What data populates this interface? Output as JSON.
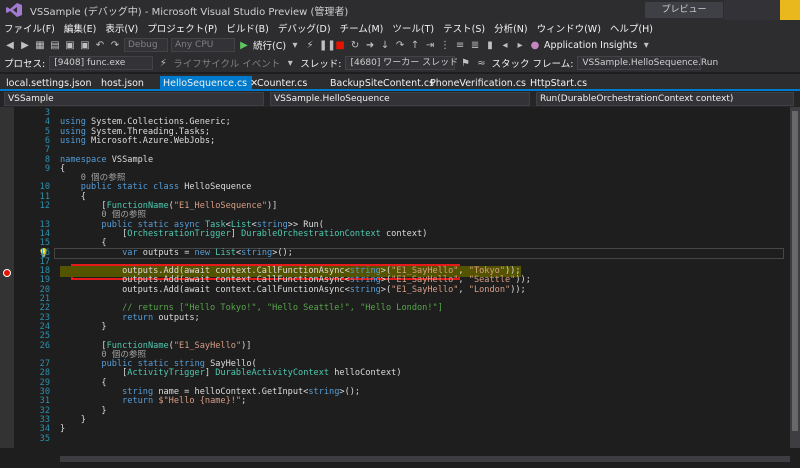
{
  "window": {
    "title": "VSSample (デバッグ中) - Microsoft Visual Studio Preview (管理者)",
    "preview_label": "プレビュー"
  },
  "menu": [
    "ファイル(F)",
    "編集(E)",
    "表示(V)",
    "プロジェクト(P)",
    "ビルド(B)",
    "デバッグ(D)",
    "チーム(M)",
    "ツール(T)",
    "テスト(S)",
    "分析(N)",
    "ウィンドウ(W)",
    "ヘルプ(H)"
  ],
  "toolbar": {
    "config": "Debug",
    "platform": "Any CPU",
    "continue_label": "続行(C)",
    "app_insights": "Application Insights"
  },
  "debugbar": {
    "process_label": "プロセス:",
    "process_value": "[9408] func.exe",
    "lifecycle_label": "ライフサイクル イベント",
    "thread_label": "スレッド:",
    "thread_value": "[4680] ワーカー スレッド",
    "stackframe_label": "スタック フレーム:",
    "stackframe_value": "VSSample.HelloSequence.Run"
  },
  "tabs": [
    {
      "label": "local.settings.json",
      "active": false
    },
    {
      "label": "host.json",
      "active": false
    },
    {
      "label": "HelloSequence.cs",
      "active": true
    },
    {
      "label": "Counter.cs",
      "active": false
    },
    {
      "label": "BackupSiteContent.cs",
      "active": false
    },
    {
      "label": "PhoneVerification.cs",
      "active": false
    },
    {
      "label": "HttpStart.cs",
      "active": false
    }
  ],
  "navbar": {
    "project": "VSSample",
    "class": "VSSample.HelloSequence",
    "member": "Run(DurableOrchestrationContext context)"
  },
  "code": {
    "line_numbers": [
      "3",
      "4",
      "5",
      "6",
      "7",
      "8",
      "9",
      "",
      "10",
      "11",
      "12",
      "",
      "13",
      "14",
      "15",
      "16",
      "17",
      "18",
      "19",
      "20",
      "21",
      "22",
      "23",
      "24",
      "25",
      "26",
      "",
      "27",
      "28",
      "29",
      "30",
      "31",
      "32",
      "33",
      "34",
      "35"
    ],
    "lines": [
      "",
      "using System.Collections.Generic;",
      "using System.Threading.Tasks;",
      "using Microsoft.Azure.WebJobs;",
      "",
      "namespace VSSample",
      "{",
      "    0 個の参照",
      "    public static class HelloSequence",
      "    {",
      "        [FunctionName(\"E1_HelloSequence\")]",
      "        0 個の参照",
      "        public static async Task<List<string>> Run(",
      "            [OrchestrationTrigger] DurableOrchestrationContext context)",
      "        {",
      "            var outputs = new List<string>();",
      "",
      "            outputs.Add(await context.CallFunctionAsync<string>(\"E1_SayHello\", \"Tokyo\"));",
      "            outputs.Add(await context.CallFunctionAsync<string>(\"E1_SayHello\", \"Seattle\"));",
      "            outputs.Add(await context.CallFunctionAsync<string>(\"E1_SayHello\", \"London\"));",
      "",
      "            // returns [\"Hello Tokyo!\", \"Hello Seattle!\", \"Hello London!\"]",
      "            return outputs;",
      "        }",
      "",
      "        [FunctionName(\"E1_SayHello\")]",
      "        0 個の参照",
      "        public static string SayHello(",
      "            [ActivityTrigger] DurableActivityContext helloContext)",
      "        {",
      "            string name = helloContext.GetInput<string>();",
      "            return $\"Hello {name}!\";",
      "        }",
      "    }",
      "}",
      ""
    ]
  }
}
